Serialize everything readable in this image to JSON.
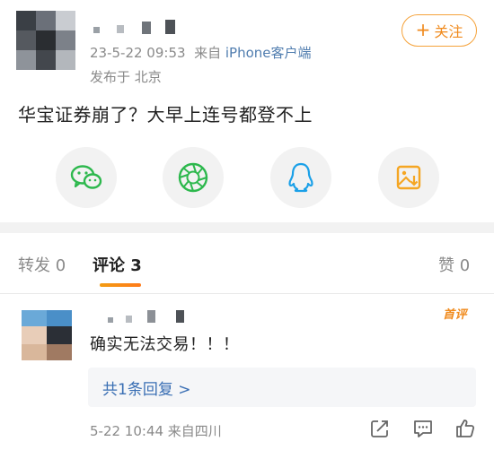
{
  "post": {
    "timestamp": "23-5-22 09:53",
    "source_prefix": "来自",
    "source_name": "iPhone客户端",
    "location": "发布于 北京",
    "follow_label": "关注",
    "text": "华宝证券崩了？大早上连号都登不上"
  },
  "share_icons": [
    "wechat-icon",
    "moments-icon",
    "qq-icon",
    "save-image-icon"
  ],
  "tabs": {
    "repost_label": "转发",
    "repost_count": "0",
    "comment_label": "评论",
    "comment_count": "3",
    "like_label": "赞",
    "like_count": "0"
  },
  "comment": {
    "badge": "首评",
    "text": "确实无法交易！！！",
    "reply_summary": "共1条回复 >",
    "time_location": "5-22 10:44 来自四川",
    "actions": [
      "share-icon",
      "comment-icon",
      "like-icon"
    ]
  },
  "colors": {
    "accent_orange": "#f08a1c",
    "link_blue": "#507daf",
    "reply_blue": "#3a6fb4",
    "wechat_green": "#2db84d",
    "qq_blue": "#1aa0e8"
  }
}
